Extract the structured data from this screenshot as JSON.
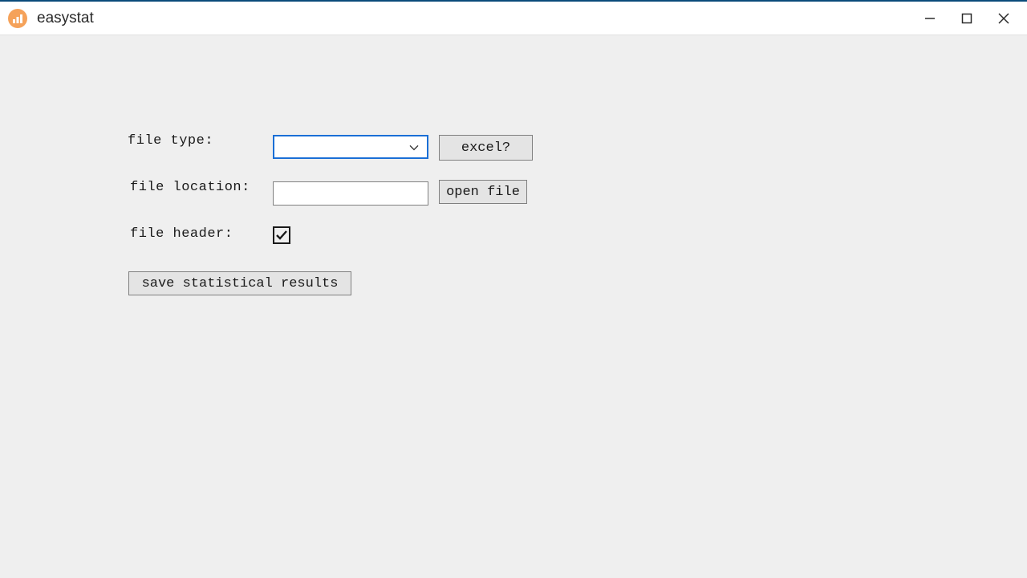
{
  "window": {
    "title": "easystat"
  },
  "form": {
    "file_type_label": "file type:",
    "file_type_value": "",
    "excel_button": "excel?",
    "file_location_label": "file location:",
    "file_location_value": "",
    "open_file_button": "open file",
    "file_header_label": "file header:",
    "file_header_checked": true,
    "save_button": "save statistical results"
  }
}
